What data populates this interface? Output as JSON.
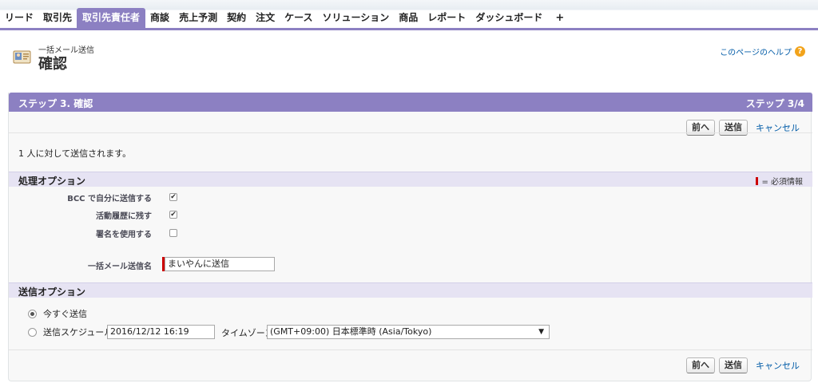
{
  "tabs": [
    {
      "label": "リード",
      "active": false
    },
    {
      "label": "取引先",
      "active": false
    },
    {
      "label": "取引先責任者",
      "active": true
    },
    {
      "label": "商談",
      "active": false
    },
    {
      "label": "売上予測",
      "active": false
    },
    {
      "label": "契約",
      "active": false
    },
    {
      "label": "注文",
      "active": false
    },
    {
      "label": "ケース",
      "active": false
    },
    {
      "label": "ソリューション",
      "active": false
    },
    {
      "label": "商品",
      "active": false
    },
    {
      "label": "レポート",
      "active": false
    },
    {
      "label": "ダッシュボード",
      "active": false
    }
  ],
  "tab_plus": "+",
  "header": {
    "type_label": "一括メール送信",
    "title": "確認",
    "help_link": "このページのヘルプ",
    "help_icon": "?"
  },
  "block": {
    "title": "ステップ 3. 確認",
    "step": "ステップ 3/4",
    "buttons": {
      "prev": "前へ",
      "send": "送信",
      "cancel": "キャンセル"
    },
    "info": "1 人に対して送信されます。"
  },
  "processing": {
    "title": "処理オプション",
    "required_note": "= 必須情報",
    "bcc_label": "BCC で自分に送信する",
    "bcc_checked": true,
    "activity_label": "活動履歴に残す",
    "activity_checked": true,
    "signature_label": "署名を使用する",
    "signature_checked": false,
    "mass_name_label": "一括メール送信名",
    "mass_name_value": "まいやんに送信"
  },
  "send_options": {
    "title": "送信オプション",
    "now_label": "今すぐ送信",
    "now_selected": true,
    "schedule_label": "送信スケジュール",
    "schedule_value": "2016/12/12 16:19",
    "timezone_label": "タイムゾーン",
    "timezone_value": "(GMT+09:00) 日本標準時 (Asia/Tokyo)"
  },
  "colors": {
    "accent": "#8c80c2",
    "section_bg": "#e6e3f3",
    "link": "#015ba7",
    "required": "#cc0000"
  }
}
